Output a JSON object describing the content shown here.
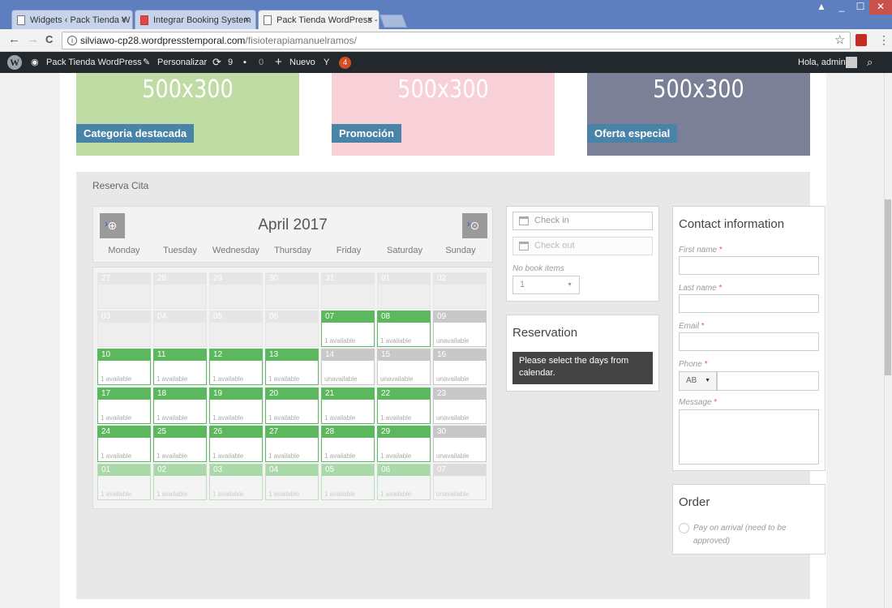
{
  "browser": {
    "tabs": [
      {
        "title": "Widgets ‹ Pack Tienda W",
        "close": "×"
      },
      {
        "title": "Integrar Booking System",
        "close": "×"
      },
      {
        "title": "Pack Tienda WordPress -",
        "close": "×"
      }
    ],
    "window_controls": {
      "user": "▲",
      "minimize": "_",
      "maximize": "☐",
      "close": "✕"
    },
    "nav": {
      "back": "←",
      "forward": "→",
      "reload": "C"
    },
    "address": {
      "host": "silviawo-cp28.wordpresstemporal.com",
      "path": "/fisioterapiamanuelramos/"
    },
    "star": "☆",
    "menu": "⋮"
  },
  "adminbar": {
    "site": "Pack Tienda WordPress",
    "customize": "Personalizar",
    "updates": "9",
    "comments": "0",
    "new": "Nuevo",
    "yoast_badge": "4",
    "greeting": "Hola, admin"
  },
  "banners": [
    {
      "text": "500x300",
      "label": "Categoria destacada",
      "color": "#bfdca4"
    },
    {
      "text": "500x300",
      "label": "Promoción",
      "color": "#f8d1d8"
    },
    {
      "text": "500x300",
      "label": "Oferta especial",
      "color": "#7b8096"
    }
  ],
  "section_title": "Reserva Cita",
  "calendar": {
    "month": "April 2017",
    "weekdays": [
      "Monday",
      "Tuesday",
      "Wednesday",
      "Thursday",
      "Friday",
      "Saturday",
      "Sunday"
    ],
    "weeks": [
      [
        {
          "d": "27",
          "s": ""
        },
        {
          "d": "28",
          "s": ""
        },
        {
          "d": "29",
          "s": ""
        },
        {
          "d": "30",
          "s": ""
        },
        {
          "d": "31",
          "s": ""
        },
        {
          "d": "01",
          "s": ""
        },
        {
          "d": "02",
          "s": ""
        }
      ],
      [
        {
          "d": "03",
          "s": ""
        },
        {
          "d": "04",
          "s": ""
        },
        {
          "d": "05",
          "s": ""
        },
        {
          "d": "06",
          "s": ""
        },
        {
          "d": "07",
          "s": "1 available"
        },
        {
          "d": "08",
          "s": "1 available"
        },
        {
          "d": "09",
          "s": "unavailable"
        }
      ],
      [
        {
          "d": "10",
          "s": "1 available"
        },
        {
          "d": "11",
          "s": "1 available"
        },
        {
          "d": "12",
          "s": "1 available"
        },
        {
          "d": "13",
          "s": "1 available"
        },
        {
          "d": "14",
          "s": "unavailable"
        },
        {
          "d": "15",
          "s": "unavailable"
        },
        {
          "d": "16",
          "s": "unavailable"
        }
      ],
      [
        {
          "d": "17",
          "s": "1 available"
        },
        {
          "d": "18",
          "s": "1 available"
        },
        {
          "d": "19",
          "s": "1 available"
        },
        {
          "d": "20",
          "s": "1 available"
        },
        {
          "d": "21",
          "s": "1 available"
        },
        {
          "d": "22",
          "s": "1 available"
        },
        {
          "d": "23",
          "s": "unavailable"
        }
      ],
      [
        {
          "d": "24",
          "s": "1 available"
        },
        {
          "d": "25",
          "s": "1 available"
        },
        {
          "d": "26",
          "s": "1 available"
        },
        {
          "d": "27",
          "s": "1 available"
        },
        {
          "d": "28",
          "s": "1 available"
        },
        {
          "d": "29",
          "s": "1 available"
        },
        {
          "d": "30",
          "s": "unavailable"
        }
      ],
      [
        {
          "d": "01",
          "s": "1 available"
        },
        {
          "d": "02",
          "s": "1 available"
        },
        {
          "d": "03",
          "s": "1 available"
        },
        {
          "d": "04",
          "s": "1 available"
        },
        {
          "d": "05",
          "s": "1 available"
        },
        {
          "d": "06",
          "s": "1 available"
        },
        {
          "d": "07",
          "s": "unavailable"
        }
      ]
    ]
  },
  "booking": {
    "checkin_placeholder": "Check in",
    "checkout_placeholder": "Check out",
    "no_book_items": "No book items",
    "qty_value": "1",
    "qty_arrow": "▼"
  },
  "reservation": {
    "title": "Reservation",
    "message": "Please select the days from calendar."
  },
  "contact": {
    "title": "Contact information",
    "first_name": "First name",
    "last_name": "Last name",
    "email": "Email",
    "phone": "Phone",
    "phone_code": "AB",
    "message": "Message",
    "required": "*"
  },
  "order": {
    "title": "Order",
    "pay_option": "Pay on arrival (need to be approved)"
  },
  "colors": {
    "available": "#5cb85c",
    "unavailable": "#c8c8c8",
    "label_bg": "#4a83a8",
    "adminbar": "#23282d"
  }
}
